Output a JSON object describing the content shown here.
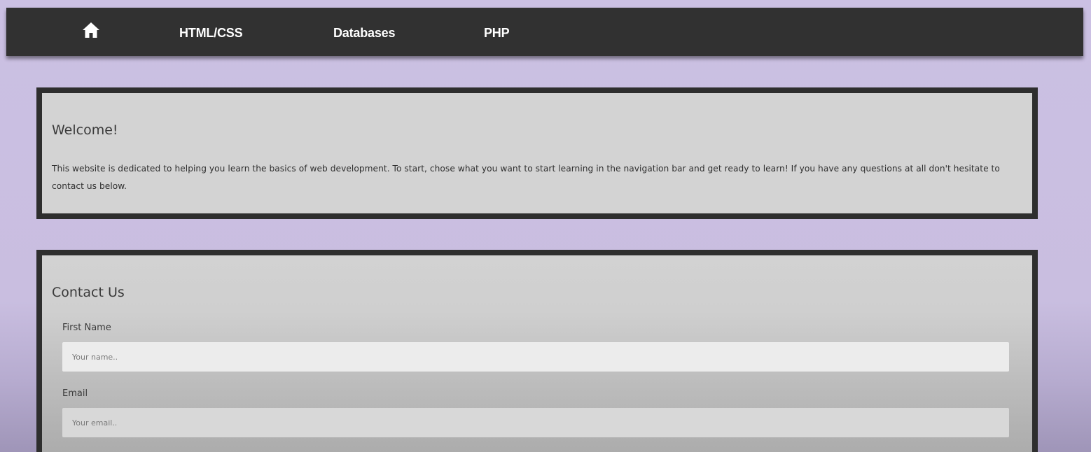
{
  "nav": {
    "home_icon": "home-icon",
    "links": [
      "HTML/CSS",
      "Databases",
      "PHP"
    ]
  },
  "welcome": {
    "title": "Welcome!",
    "text": "This website is dedicated to helping you learn the basics of web development. To start, chose what you want to start learning in the navigation bar and get ready to learn! If you have any questions at all don't hesitate to contact us below."
  },
  "contact": {
    "title": "Contact Us",
    "first_name_label": "First Name",
    "first_name_placeholder": "Your name..",
    "email_label": "Email",
    "email_placeholder": "Your email.."
  },
  "colors": {
    "page_background": "#cbc0e3",
    "navbar": "#313131",
    "panel_background": "#d3d3d3",
    "panel_border": "#2e2e2e"
  }
}
